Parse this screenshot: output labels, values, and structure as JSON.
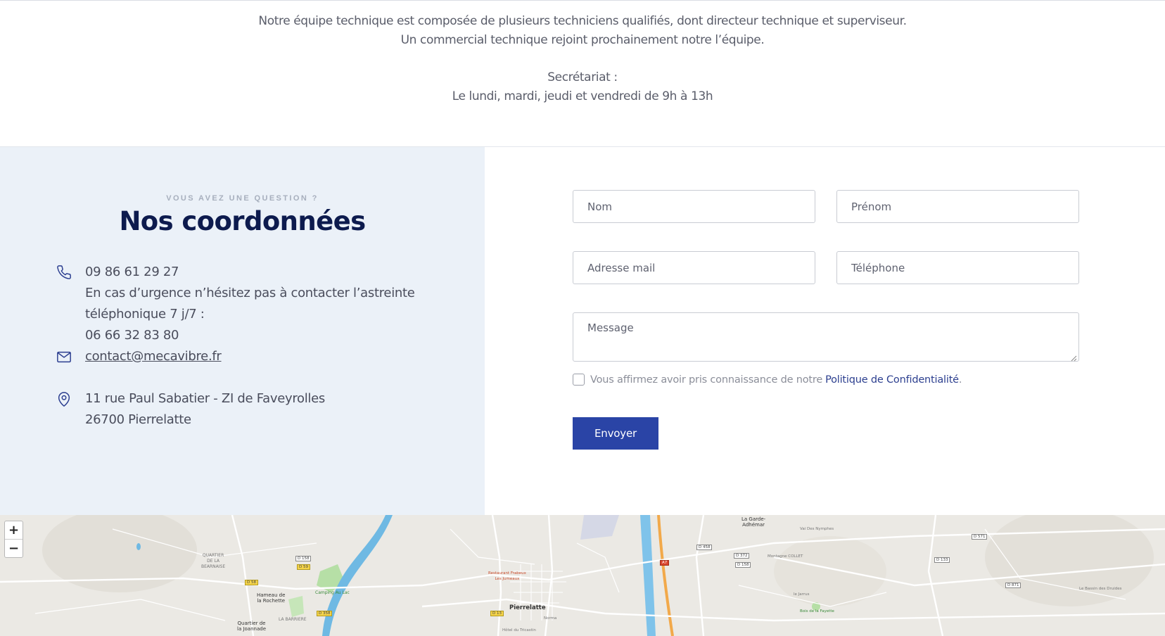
{
  "intro": {
    "lines": [
      "Notre équipe technique est composée de plusieurs techniciens qualifiés, dont directeur technique et superviseur.",
      "Un commercial technique rejoint prochainement notre l’équipe.",
      "Secrétariat :",
      "Le lundi, mardi, jeudi et vendredi de 9h à 13h"
    ]
  },
  "contact": {
    "eyebrow": "VOUS AVEZ UNE QUESTION ?",
    "title": "Nos coordonnées",
    "phone": {
      "icon": "phone-icon",
      "number": "09 86 61 29 27",
      "urgency_line1": "En cas d’urgence n’hésitez pas à contacter l’astreinte",
      "urgency_line2": "téléphonique 7 j/7 :",
      "urgency_number": "06 66 32 83 80"
    },
    "email": {
      "icon": "mail-icon",
      "address": "contact@mecavibre.fr"
    },
    "address": {
      "icon": "location-pin-icon",
      "line1": "11 rue Paul Sabatier - ZI de Faveyrolles",
      "line2": "26700 Pierrelatte"
    }
  },
  "form": {
    "nom_placeholder": "Nom",
    "prenom_placeholder": "Prénom",
    "email_placeholder": "Adresse mail",
    "telephone_placeholder": "Téléphone",
    "message_placeholder": "Message",
    "consent_text": "Vous affirmez avoir pris connaissance de notre",
    "policy_link": "Politique de Confidentialité",
    "consent_end": ".",
    "submit_label": "Envoyer"
  },
  "map": {
    "zoom_in": "+",
    "zoom_out": "−",
    "labels": {
      "pierrelatte": "Pierrelatte",
      "la_garde": "La Garde-\nAdhémar",
      "hameau": "Hameau de\nla Rochette",
      "quartier_joannade": "Quartier de\nla Joannade",
      "quartier_bearnaise": "QUARTIER\nDE LA\nBEARNAISE",
      "la_barriere": "LA BARRIERE",
      "camping": "Camping Au Lac",
      "restaurant": "Restaurant Frabeux\nLes Jumeaux",
      "vai_des_nymphes": "Vai Des Nymphes",
      "montagne_collet": "Montagne COLLET",
      "bois_fayette": "Bois de la Fayette",
      "le_jarrus": "le Jarrus",
      "bassin_druides": "Le Bassin des Druides",
      "hotel": "Hôtel du Tricastin",
      "norma": "Norma"
    },
    "roads": {
      "d158": "D 158",
      "d59": "D 59",
      "d58": "D 58",
      "d358": "D 358",
      "a7": "A7",
      "d13": "D 13",
      "d458": "D 458",
      "d372": "D 372",
      "d158b": "D 158",
      "d133": "D 133",
      "d571": "D 571",
      "d871": "D 871"
    },
    "colors": {
      "water": "#6fb9e3",
      "highway": "#f2a94a",
      "park": "#b6dfa6",
      "land": "#ebe9e4"
    }
  }
}
